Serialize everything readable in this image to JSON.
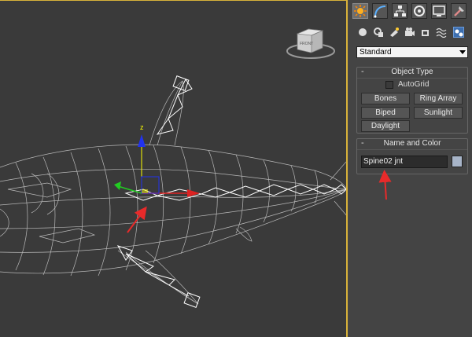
{
  "viewport": {
    "viewcube_label": "FRONT",
    "gizmo_axis_label": "z",
    "colors": {
      "background": "#3a3a3a",
      "wireframe": "#cfcfcf",
      "annotation_arrow": "#e82a2a",
      "active_border": "#d8b23a"
    }
  },
  "command_panel": {
    "tabs": [
      {
        "icon": "create-icon"
      },
      {
        "icon": "modify-icon"
      },
      {
        "icon": "hierarchy-icon"
      },
      {
        "icon": "motion-icon"
      },
      {
        "icon": "display-icon"
      },
      {
        "icon": "utilities-icon"
      }
    ],
    "subtabs": [
      {
        "icon": "geometry-icon"
      },
      {
        "icon": "shapes-icon"
      },
      {
        "icon": "lights-icon"
      },
      {
        "icon": "cameras-icon"
      },
      {
        "icon": "helpers-icon"
      },
      {
        "icon": "spacewarps-icon"
      },
      {
        "icon": "systems-icon"
      }
    ],
    "category_dropdown": {
      "value": "Standard"
    },
    "object_type": {
      "title": "Object Type",
      "collapse_symbol": "-",
      "autogrid_label": "AutoGrid",
      "autogrid_checked": false,
      "buttons": [
        "Bones",
        "Ring Array",
        "Biped",
        "Sunlight",
        "Daylight"
      ]
    },
    "name_and_color": {
      "title": "Name and Color",
      "collapse_symbol": "-",
      "name_value": "Spine02 jnt",
      "color_swatch": "#a7b4c8"
    }
  }
}
